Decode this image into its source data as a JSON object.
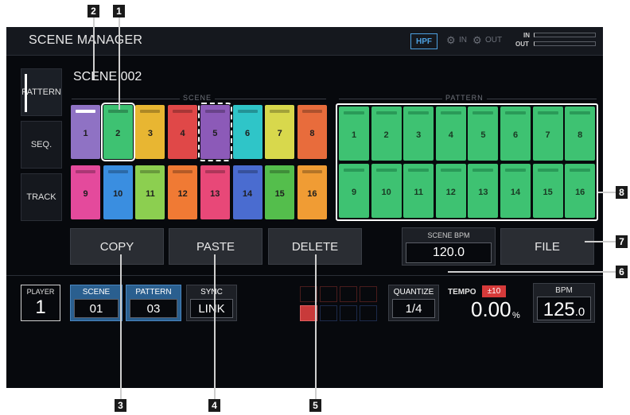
{
  "callouts": [
    "1",
    "2",
    "3",
    "4",
    "5",
    "6",
    "7",
    "8"
  ],
  "header": {
    "title": "SCENE MANAGER",
    "hpf": "HPF",
    "in_label": "IN",
    "out_label": "OUT",
    "meter_in": "IN",
    "meter_out": "OUT"
  },
  "sidebar": {
    "items": [
      {
        "label": "PATTERN",
        "active": true
      },
      {
        "label": "SEQ.",
        "active": false
      },
      {
        "label": "TRACK",
        "active": false
      }
    ]
  },
  "scene_name": "SCENE 002",
  "scene_section": {
    "label": "SCENE",
    "pads": [
      {
        "num": "1",
        "color": "#8f72c4",
        "stripe": "white"
      },
      {
        "num": "2",
        "color": "#3ec272",
        "selected": true
      },
      {
        "num": "3",
        "color": "#e8b632"
      },
      {
        "num": "4",
        "color": "#e04848"
      },
      {
        "num": "5",
        "color": "#8c5ab8",
        "dashed": true
      },
      {
        "num": "6",
        "color": "#2fc5c8"
      },
      {
        "num": "7",
        "color": "#d8d84c"
      },
      {
        "num": "8",
        "color": "#e86c3c"
      },
      {
        "num": "9",
        "color": "#e44a9c"
      },
      {
        "num": "10",
        "color": "#3a8ee0"
      },
      {
        "num": "11",
        "color": "#8ccf50"
      },
      {
        "num": "12",
        "color": "#f07a34"
      },
      {
        "num": "13",
        "color": "#e84878"
      },
      {
        "num": "14",
        "color": "#4a6cd0"
      },
      {
        "num": "15",
        "color": "#54be4c"
      },
      {
        "num": "16",
        "color": "#f09c34"
      }
    ]
  },
  "pattern_section": {
    "label": "PATTERN",
    "pads": [
      "1",
      "2",
      "3",
      "4",
      "5",
      "6",
      "7",
      "8",
      "9",
      "10",
      "11",
      "12",
      "13",
      "14",
      "15",
      "16"
    ]
  },
  "buttons": {
    "copy": "COPY",
    "paste": "PASTE",
    "delete": "DELETE",
    "file": "FILE"
  },
  "scene_bpm": {
    "label": "SCENE BPM",
    "value": "120.0"
  },
  "player": {
    "label": "PLAYER",
    "number": "1"
  },
  "scene_field": {
    "label": "SCENE",
    "value": "01"
  },
  "pattern_field": {
    "label": "PATTERN",
    "value": "03"
  },
  "sync_field": {
    "label": "SYNC",
    "value": "LINK"
  },
  "quantize": {
    "label": "QUANTIZE",
    "value": "1/4"
  },
  "tempo": {
    "label": "TEMPO",
    "range": "±10",
    "value": "0.00",
    "unit": "%"
  },
  "bpm": {
    "label": "BPM",
    "int": "125",
    "dec": ".0"
  }
}
